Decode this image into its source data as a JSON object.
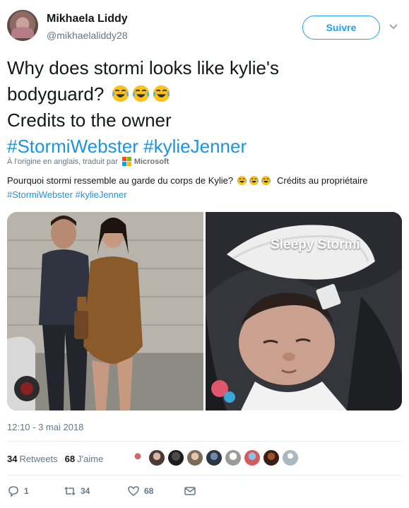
{
  "author": {
    "display_name": "Mikhaela Liddy",
    "handle": "@mikhaelaliddy28"
  },
  "follow_button": {
    "label": "Suivre"
  },
  "tweet": {
    "line1": "Why does stormi looks like kylie's",
    "line2": "bodyguard?",
    "line3": "Credits to the owner",
    "hashtag1": "#StormiWebster",
    "hashtag2": "#kylieJenner",
    "emoji_count": 3,
    "emoji_name": "face-with-tears-of-joy"
  },
  "translation_notice": {
    "label": "À l'origine en anglais, traduit par",
    "provider": "Microsoft"
  },
  "translation": {
    "text_before": "Pourquoi stormi ressemble au garde du corps de Kylie?",
    "text_after": "Crédits au propriétaire",
    "hashtag1": "#StormiWebster",
    "hashtag2": "#kylieJenner"
  },
  "media": {
    "right_caption": "Sleepy Stormi"
  },
  "timestamp": "12:10 - 3 mai 2018",
  "stats": {
    "retweets_count": "34",
    "retweets_label": "Retweets",
    "likes_count": "68",
    "likes_label": "J'aime"
  },
  "actions": {
    "reply_count": "1",
    "retweet_count": "34",
    "like_count": "68"
  },
  "colors": {
    "accent": "#1da1f2",
    "hashtag": "#1b95e0",
    "muted": "#657786",
    "text": "#14171a"
  }
}
